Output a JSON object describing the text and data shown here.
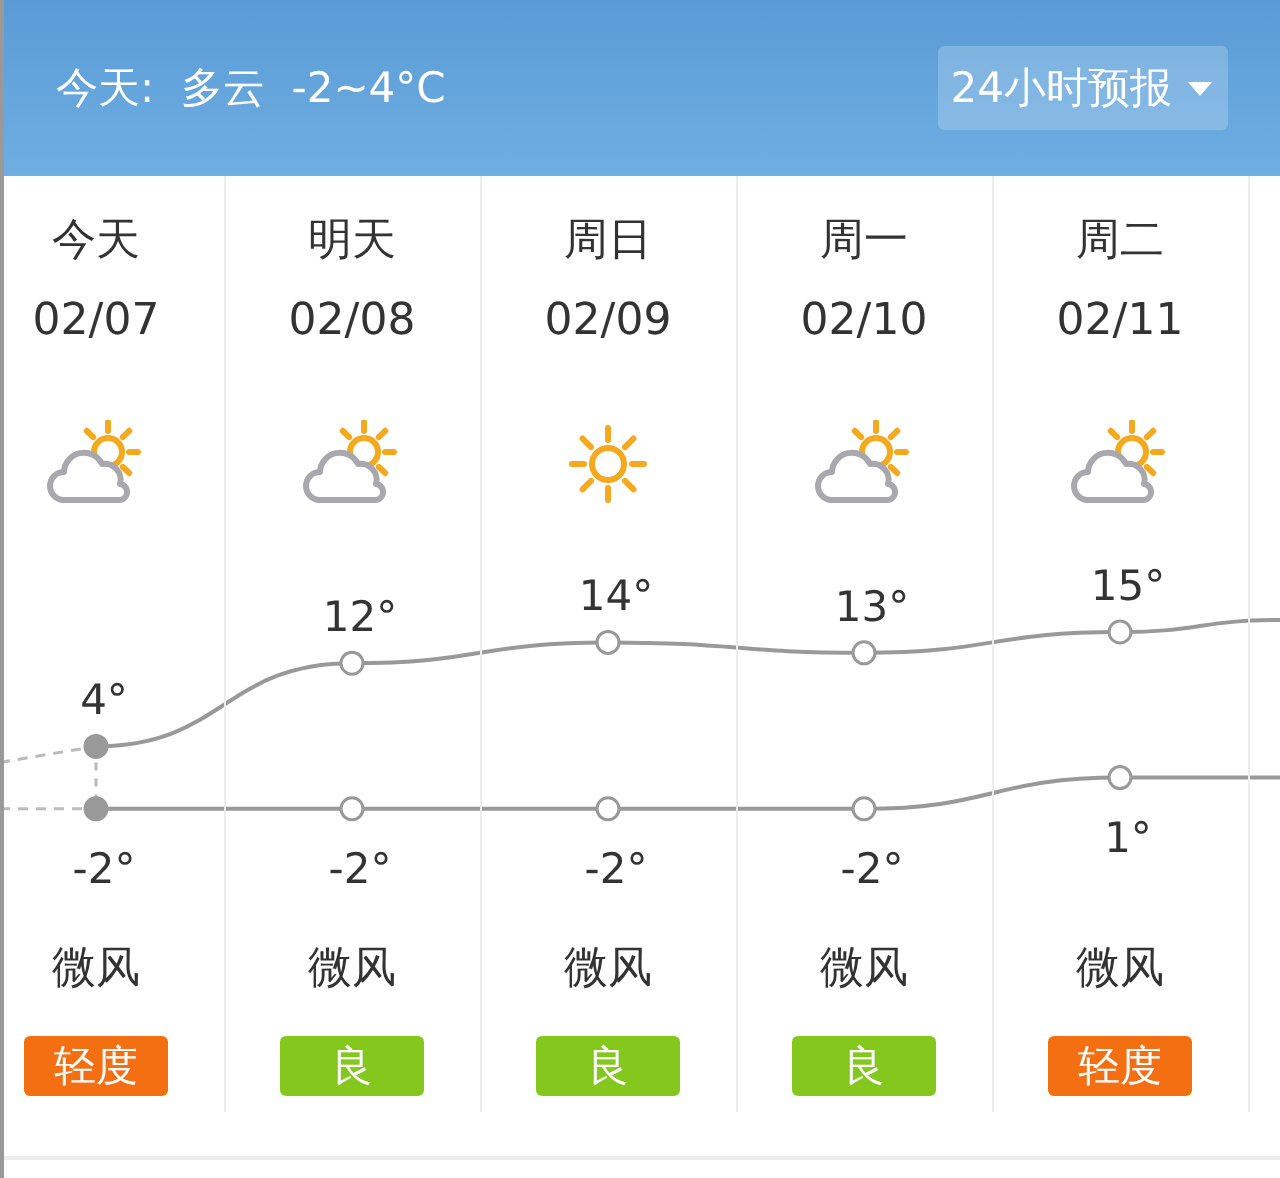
{
  "header": {
    "summary": "今天:  多云  -2~4°C",
    "forecast_button": "24小时预报"
  },
  "days": [
    {
      "name": "今天",
      "date": "02/07",
      "kind": "partly-cloudy",
      "high": "4°",
      "low": "-2°",
      "current": true,
      "wind": "微风",
      "aqi": "轻度",
      "color": "#f36f11"
    },
    {
      "name": "明天",
      "date": "02/08",
      "kind": "partly-cloudy",
      "high": "12°",
      "low": "-2°",
      "current": false,
      "wind": "微风",
      "aqi": "良",
      "color": "#84c81e"
    },
    {
      "name": "周日",
      "date": "02/09",
      "kind": "sunny",
      "high": "14°",
      "low": "-2°",
      "current": false,
      "wind": "微风",
      "aqi": "良",
      "color": "#84c81e"
    },
    {
      "name": "周一",
      "date": "02/10",
      "kind": "partly-cloudy",
      "high": "13°",
      "low": "-2°",
      "current": false,
      "wind": "微风",
      "aqi": "良",
      "color": "#84c81e"
    },
    {
      "name": "周二",
      "date": "02/11",
      "kind": "partly-cloudy",
      "high": "15°",
      "low": "1°",
      "current": false,
      "wind": "微风",
      "aqi": "轻度",
      "color": "#f36f11"
    }
  ]
}
